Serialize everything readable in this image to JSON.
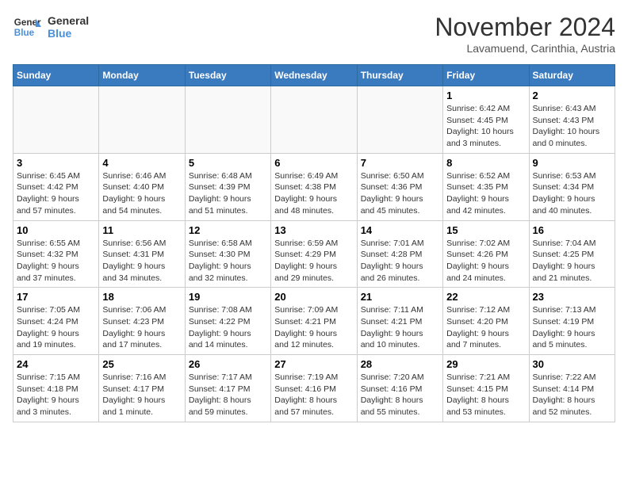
{
  "logo": {
    "text_general": "General",
    "text_blue": "Blue"
  },
  "title": "November 2024",
  "subtitle": "Lavamuend, Carinthia, Austria",
  "weekdays": [
    "Sunday",
    "Monday",
    "Tuesday",
    "Wednesday",
    "Thursday",
    "Friday",
    "Saturday"
  ],
  "weeks": [
    [
      {
        "day": "",
        "info": ""
      },
      {
        "day": "",
        "info": ""
      },
      {
        "day": "",
        "info": ""
      },
      {
        "day": "",
        "info": ""
      },
      {
        "day": "",
        "info": ""
      },
      {
        "day": "1",
        "info": "Sunrise: 6:42 AM\nSunset: 4:45 PM\nDaylight: 10 hours\nand 3 minutes."
      },
      {
        "day": "2",
        "info": "Sunrise: 6:43 AM\nSunset: 4:43 PM\nDaylight: 10 hours\nand 0 minutes."
      }
    ],
    [
      {
        "day": "3",
        "info": "Sunrise: 6:45 AM\nSunset: 4:42 PM\nDaylight: 9 hours\nand 57 minutes."
      },
      {
        "day": "4",
        "info": "Sunrise: 6:46 AM\nSunset: 4:40 PM\nDaylight: 9 hours\nand 54 minutes."
      },
      {
        "day": "5",
        "info": "Sunrise: 6:48 AM\nSunset: 4:39 PM\nDaylight: 9 hours\nand 51 minutes."
      },
      {
        "day": "6",
        "info": "Sunrise: 6:49 AM\nSunset: 4:38 PM\nDaylight: 9 hours\nand 48 minutes."
      },
      {
        "day": "7",
        "info": "Sunrise: 6:50 AM\nSunset: 4:36 PM\nDaylight: 9 hours\nand 45 minutes."
      },
      {
        "day": "8",
        "info": "Sunrise: 6:52 AM\nSunset: 4:35 PM\nDaylight: 9 hours\nand 42 minutes."
      },
      {
        "day": "9",
        "info": "Sunrise: 6:53 AM\nSunset: 4:34 PM\nDaylight: 9 hours\nand 40 minutes."
      }
    ],
    [
      {
        "day": "10",
        "info": "Sunrise: 6:55 AM\nSunset: 4:32 PM\nDaylight: 9 hours\nand 37 minutes."
      },
      {
        "day": "11",
        "info": "Sunrise: 6:56 AM\nSunset: 4:31 PM\nDaylight: 9 hours\nand 34 minutes."
      },
      {
        "day": "12",
        "info": "Sunrise: 6:58 AM\nSunset: 4:30 PM\nDaylight: 9 hours\nand 32 minutes."
      },
      {
        "day": "13",
        "info": "Sunrise: 6:59 AM\nSunset: 4:29 PM\nDaylight: 9 hours\nand 29 minutes."
      },
      {
        "day": "14",
        "info": "Sunrise: 7:01 AM\nSunset: 4:28 PM\nDaylight: 9 hours\nand 26 minutes."
      },
      {
        "day": "15",
        "info": "Sunrise: 7:02 AM\nSunset: 4:26 PM\nDaylight: 9 hours\nand 24 minutes."
      },
      {
        "day": "16",
        "info": "Sunrise: 7:04 AM\nSunset: 4:25 PM\nDaylight: 9 hours\nand 21 minutes."
      }
    ],
    [
      {
        "day": "17",
        "info": "Sunrise: 7:05 AM\nSunset: 4:24 PM\nDaylight: 9 hours\nand 19 minutes."
      },
      {
        "day": "18",
        "info": "Sunrise: 7:06 AM\nSunset: 4:23 PM\nDaylight: 9 hours\nand 17 minutes."
      },
      {
        "day": "19",
        "info": "Sunrise: 7:08 AM\nSunset: 4:22 PM\nDaylight: 9 hours\nand 14 minutes."
      },
      {
        "day": "20",
        "info": "Sunrise: 7:09 AM\nSunset: 4:21 PM\nDaylight: 9 hours\nand 12 minutes."
      },
      {
        "day": "21",
        "info": "Sunrise: 7:11 AM\nSunset: 4:21 PM\nDaylight: 9 hours\nand 10 minutes."
      },
      {
        "day": "22",
        "info": "Sunrise: 7:12 AM\nSunset: 4:20 PM\nDaylight: 9 hours\nand 7 minutes."
      },
      {
        "day": "23",
        "info": "Sunrise: 7:13 AM\nSunset: 4:19 PM\nDaylight: 9 hours\nand 5 minutes."
      }
    ],
    [
      {
        "day": "24",
        "info": "Sunrise: 7:15 AM\nSunset: 4:18 PM\nDaylight: 9 hours\nand 3 minutes."
      },
      {
        "day": "25",
        "info": "Sunrise: 7:16 AM\nSunset: 4:17 PM\nDaylight: 9 hours\nand 1 minute."
      },
      {
        "day": "26",
        "info": "Sunrise: 7:17 AM\nSunset: 4:17 PM\nDaylight: 8 hours\nand 59 minutes."
      },
      {
        "day": "27",
        "info": "Sunrise: 7:19 AM\nSunset: 4:16 PM\nDaylight: 8 hours\nand 57 minutes."
      },
      {
        "day": "28",
        "info": "Sunrise: 7:20 AM\nSunset: 4:16 PM\nDaylight: 8 hours\nand 55 minutes."
      },
      {
        "day": "29",
        "info": "Sunrise: 7:21 AM\nSunset: 4:15 PM\nDaylight: 8 hours\nand 53 minutes."
      },
      {
        "day": "30",
        "info": "Sunrise: 7:22 AM\nSunset: 4:14 PM\nDaylight: 8 hours\nand 52 minutes."
      }
    ]
  ]
}
